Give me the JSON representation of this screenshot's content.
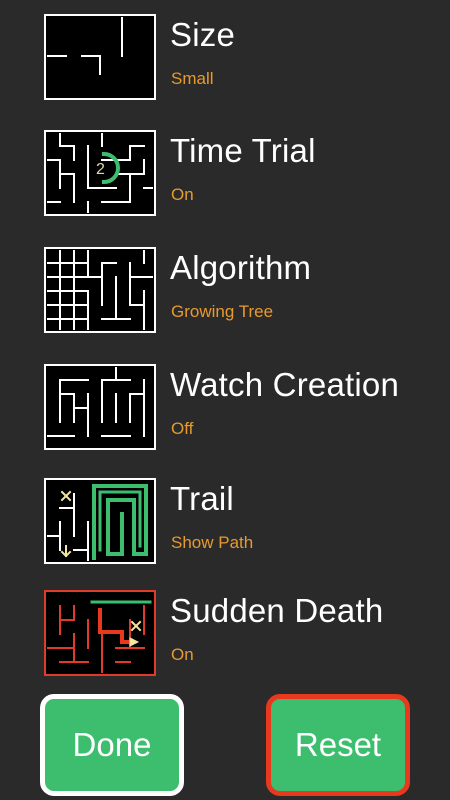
{
  "settings": [
    {
      "id": "size",
      "title": "Size",
      "value": "Small",
      "icon": "maze-size-icon"
    },
    {
      "id": "time-trial",
      "title": "Time Trial",
      "value": "On",
      "icon": "maze-timer-icon",
      "timer_digit": "2"
    },
    {
      "id": "algorithm",
      "title": "Algorithm",
      "value": "Growing Tree",
      "icon": "maze-algorithm-icon"
    },
    {
      "id": "watch-creation",
      "title": "Watch Creation",
      "value": "Off",
      "icon": "maze-creation-icon"
    },
    {
      "id": "trail",
      "title": "Trail",
      "value": "Show Path",
      "icon": "maze-trail-icon"
    },
    {
      "id": "sudden-death",
      "title": "Sudden Death",
      "value": "On",
      "icon": "maze-sudden-death-icon"
    }
  ],
  "buttons": {
    "done": "Done",
    "reset": "Reset"
  },
  "colors": {
    "background": "#2a2a2a",
    "value_text": "#e89a2e",
    "button_green": "#3dbe6e",
    "reset_border": "#e8391f",
    "sudden_death_red": "#e03a2a",
    "trail_green": "#3dbe6e"
  }
}
